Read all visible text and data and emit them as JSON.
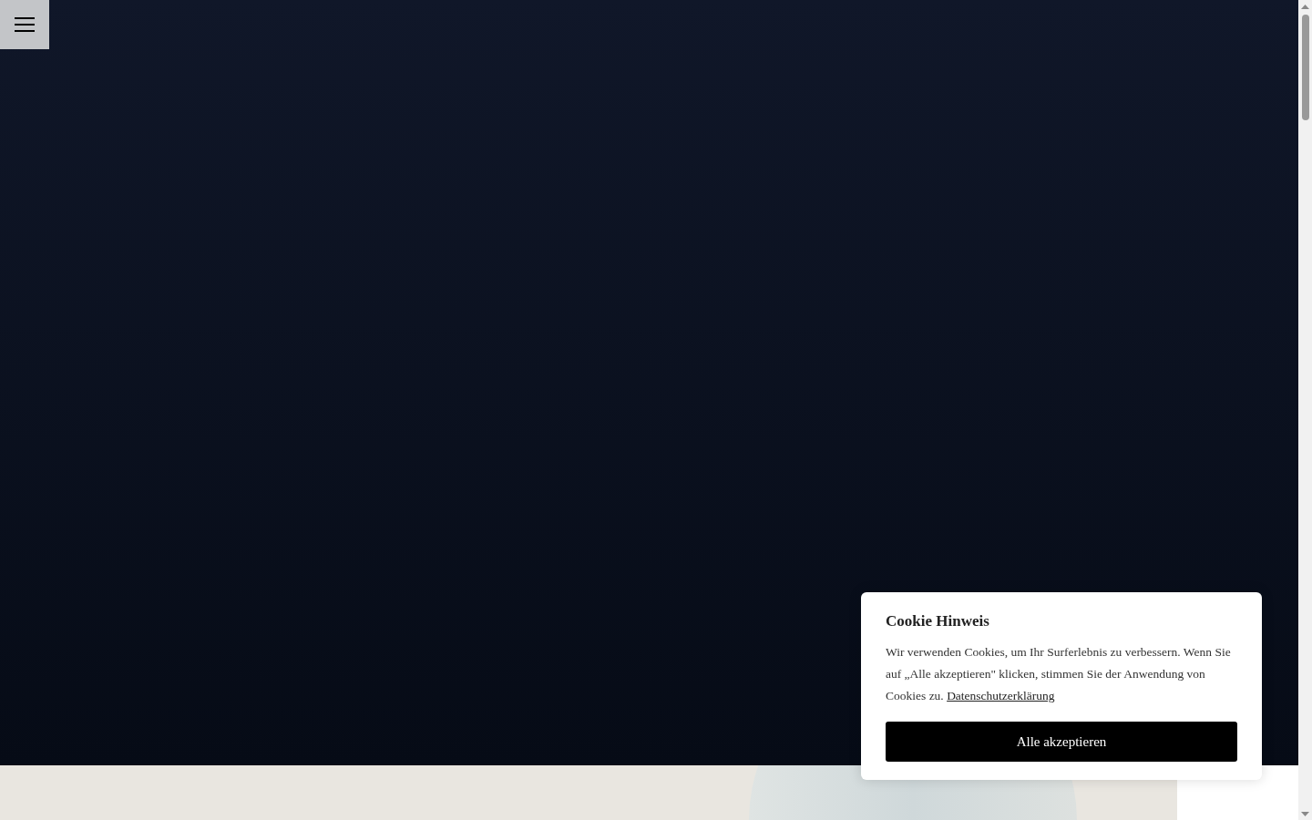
{
  "menu_button": {
    "kind": "hamburger"
  },
  "cookie_notice": {
    "title": "Cookie Hinweis",
    "text": "Wir verwenden Cookies, um Ihr Surferlebnis zu verbessern. Wenn Sie auf „Alle akzeptieren\" klicken, stimmen Sie der Anwendung von Cookies zu.",
    "link": "Datenschutzerklärung",
    "button": "Alle akzeptieren"
  }
}
